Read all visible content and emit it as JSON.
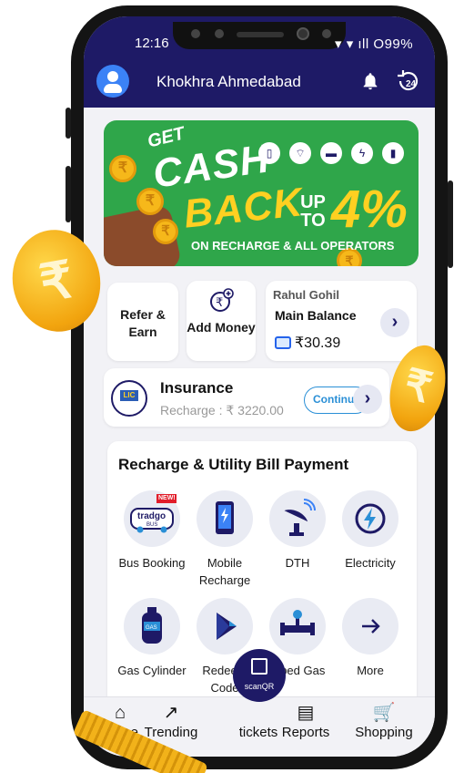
{
  "status_bar": {
    "time": "12:16",
    "indicators": "▾ ▾ ∥ıl O 99%",
    "battery": "99%"
  },
  "header": {
    "location": "Khokhra Ahmedabad",
    "icons": [
      "avatar",
      "bell-icon",
      "history-24-icon"
    ]
  },
  "banner": {
    "line1": "GET",
    "line2": "CASH",
    "line3": "BACK",
    "upto": "UP TO",
    "percent": "4%",
    "subtitle": "ON RECHARGE & ALL OPERATORS"
  },
  "quick_actions": {
    "refer": "Refer & Earn",
    "add_money": "Add Money"
  },
  "balance": {
    "name": "Rahul Gohil",
    "title": "Main Balance",
    "amount": "₹30.39"
  },
  "insurance": {
    "logo_text": "LIC",
    "title": "Insurance",
    "subtitle": "Recharge : ₹ 3220.00",
    "button": "Continue"
  },
  "services": {
    "title": "Recharge & Utility Bill Payment",
    "items": [
      {
        "label": "Bus Booking",
        "badge": "NEW!",
        "logo": "tradgo"
      },
      {
        "label": "Mobile Recharge"
      },
      {
        "label": "DTH"
      },
      {
        "label": "Electricity"
      },
      {
        "label": "Gas Cylinder"
      },
      {
        "label": "Redeem Code"
      },
      {
        "label": "Piped Gas"
      },
      {
        "label": "More"
      }
    ]
  },
  "bottom_nav": {
    "items": [
      {
        "label": "Home"
      },
      {
        "label": "Trending"
      },
      {
        "label": "tickets"
      },
      {
        "label": "Reports"
      },
      {
        "label": "Shopping"
      }
    ],
    "scan_label": "scanQR"
  },
  "colors": {
    "primary": "#1e1a66",
    "banner_green": "#2fa64a",
    "accent_yellow": "#ffd021",
    "link_blue": "#2a8fd6"
  }
}
